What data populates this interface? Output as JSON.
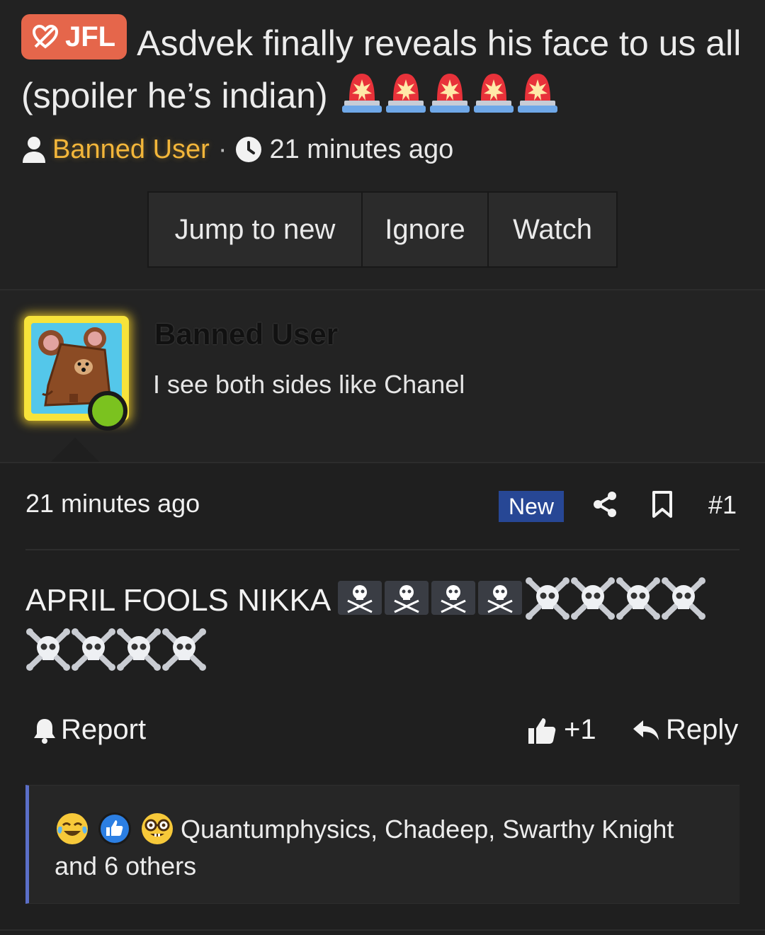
{
  "thread": {
    "prefix_label": "JFL",
    "title": "Asdvek finally reveals his face to us all (spoiler he’s indian)",
    "author": "Banned User",
    "separator": "·",
    "time": "21 minutes ago",
    "siren_count": 5
  },
  "actions": {
    "jump": "Jump to new",
    "ignore": "Ignore",
    "watch": "Watch"
  },
  "post": {
    "author": "Banned User",
    "user_title": "I see both sides like Chanel",
    "time": "21 minutes ago",
    "new_badge": "New",
    "number": "#1",
    "body_text": "APRIL FOOLS NIKKA",
    "report": "Report",
    "like_count": "+1",
    "reply": "Reply"
  },
  "reactions": {
    "text": "Quantumphysics, Chadeep, Swarthy Knight and 6 others",
    "icons": [
      "crying-laughing",
      "thumbs-up",
      "nerd-face"
    ]
  },
  "colors": {
    "prefix": "#e5664b",
    "username": "#f3b63a",
    "new_badge": "#274795",
    "reaction_border": "#5b6fc8",
    "online": "#7bc21f"
  }
}
